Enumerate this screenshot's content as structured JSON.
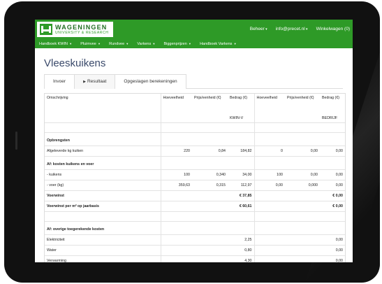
{
  "navbar": {
    "logo_name": "WAGENINGEN",
    "logo_sub": "UNIVERSITY & RESEARCH",
    "top_links": [
      "Beheer",
      "info@precet.nl",
      "Winkelwagen (0)"
    ],
    "menu": [
      "Handboek KWIN",
      "Pluimvee",
      "Rundvee",
      "Varkens",
      "Biggenprijzen",
      "Handboek Varkens"
    ]
  },
  "page": {
    "title": "Vleeskuikens",
    "tabs": [
      "Invoer",
      "Resultaat",
      "Opgeslagen berekeningen"
    ]
  },
  "table": {
    "headers": [
      "Omschrijving",
      "Hoeveelheid",
      "Prijs/eenheid (€)",
      "Bedrag (€)",
      "Hoeveelheid",
      "Prijs/eenheid (€)",
      "Bedrag (€)"
    ],
    "subheaders": [
      "",
      "",
      "",
      "KWIN-V",
      "",
      "",
      "BEDRIJF"
    ],
    "rows": [
      {
        "kind": "blank",
        "cells": [
          "",
          "",
          "",
          "",
          "",
          "",
          ""
        ]
      },
      {
        "kind": "section",
        "cells": [
          "Opbrengsten",
          "",
          "",
          "",
          "",
          "",
          ""
        ]
      },
      {
        "kind": "data",
        "cells": [
          "Afgeleverde kg kuiken",
          "220",
          "0,84",
          "184,82",
          "0",
          "0,00",
          "0,00"
        ]
      },
      {
        "kind": "section",
        "cells": [
          "Af: kosten kuikens en voer",
          "",
          "",
          "",
          "",
          "",
          ""
        ]
      },
      {
        "kind": "data",
        "cells": [
          "- kuikens",
          "100",
          "0,340",
          "34,00",
          "100",
          "0,00",
          "0,00"
        ]
      },
      {
        "kind": "data",
        "cells": [
          "- voer (kg)",
          "359,63",
          "0,315",
          "112,97",
          "0,00",
          "0,000",
          "0,00"
        ]
      },
      {
        "kind": "bold",
        "cells": [
          "Voerwinst",
          "",
          "",
          "€ 37,85",
          "",
          "",
          "€ 0,00"
        ]
      },
      {
        "kind": "bold",
        "cells": [
          "Voerwinst per m² op jaarbasis",
          "",
          "",
          "€ 60,61",
          "",
          "",
          "€ 0,00"
        ]
      },
      {
        "kind": "blank",
        "cells": [
          "",
          "",
          "",
          "",
          "",
          "",
          ""
        ]
      },
      {
        "kind": "section",
        "cells": [
          "Af: overige toegerekende kosten",
          "",
          "",
          "",
          "",
          "",
          ""
        ]
      },
      {
        "kind": "data",
        "cells": [
          "Elektriciteit",
          "",
          "",
          "2,25",
          "",
          "",
          "0,00"
        ]
      },
      {
        "kind": "data",
        "cells": [
          "Water",
          "",
          "",
          "0,80",
          "",
          "",
          "0,00"
        ]
      },
      {
        "kind": "data",
        "cells": [
          "Verwarming",
          "",
          "",
          "4,30",
          "",
          "",
          "0,00"
        ]
      }
    ]
  },
  "colors": {
    "brand_green": "#2e9a27",
    "title_color": "#3b4a6b"
  }
}
